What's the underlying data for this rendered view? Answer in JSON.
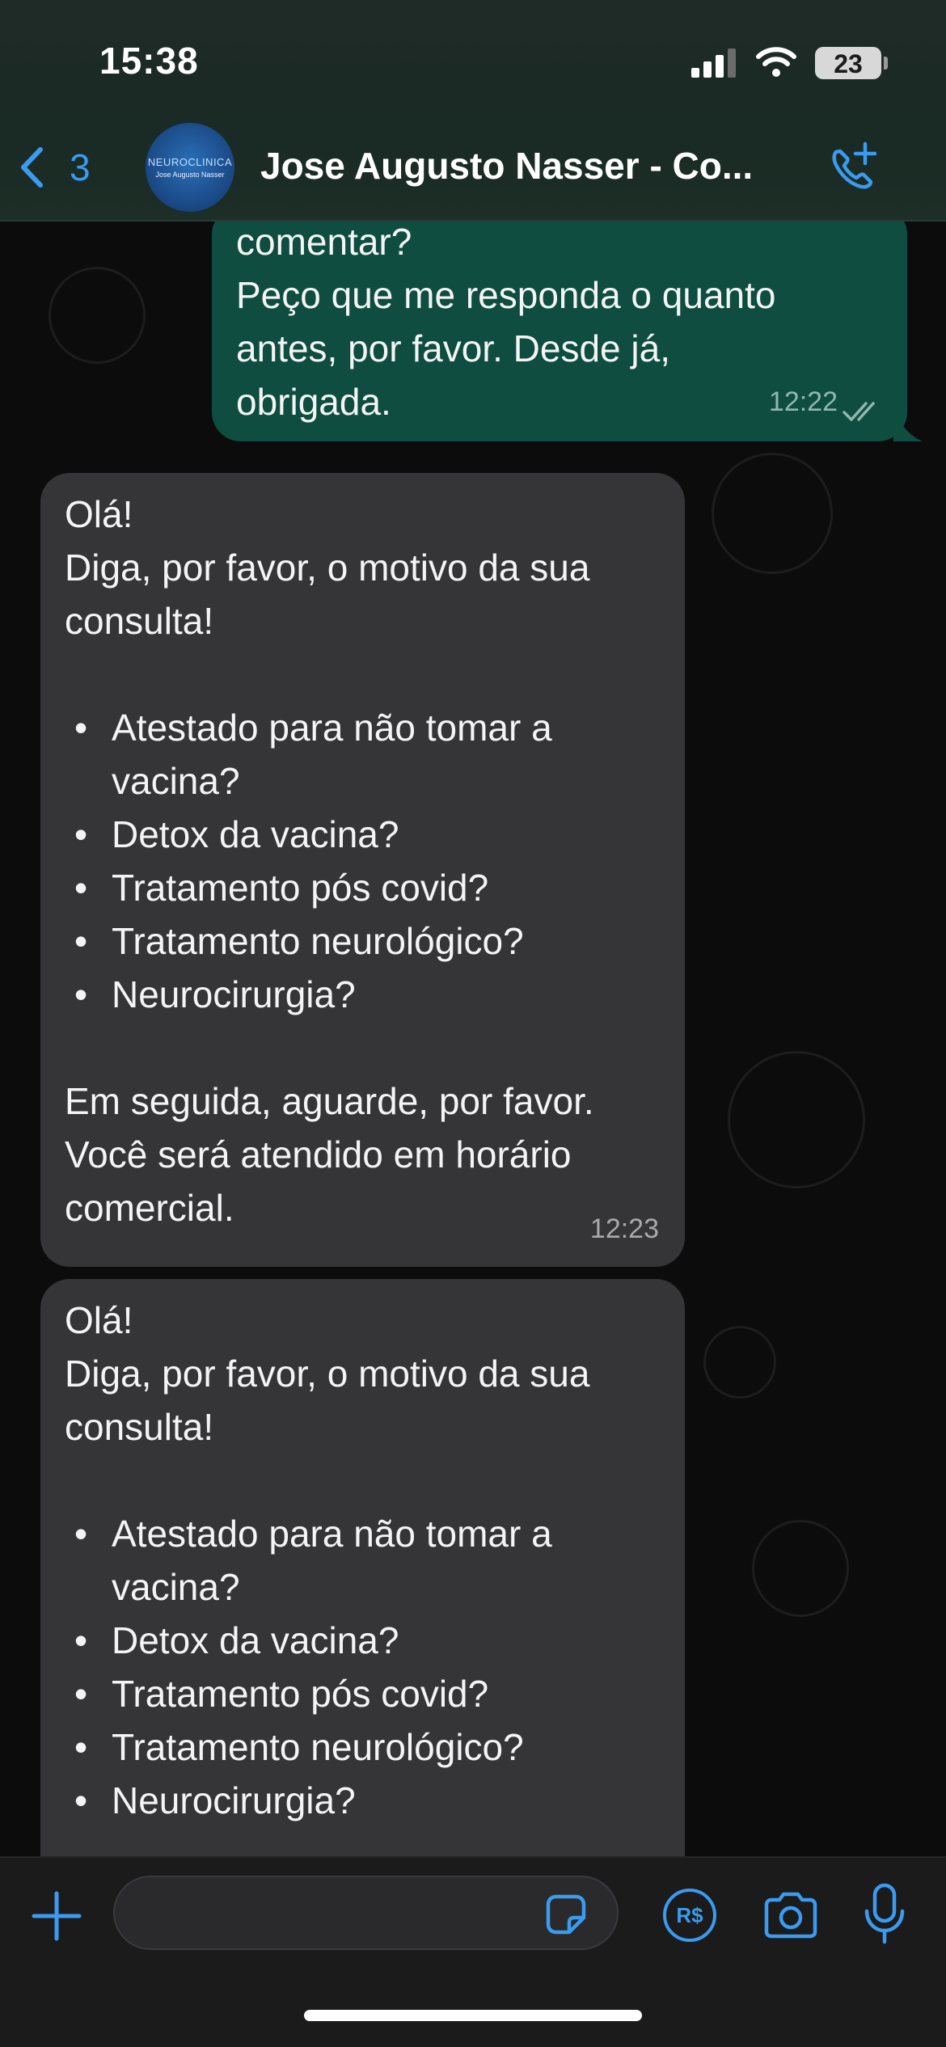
{
  "status_bar": {
    "time": "15:38",
    "battery": "23"
  },
  "header": {
    "back_count": "3",
    "contact_name": "Jose Augusto Nasser - Co...",
    "avatar_text_1": "NEUROCLINICA",
    "avatar_text_2": "Jose Augusto Nasser"
  },
  "messages": [
    {
      "direction": "outgoing",
      "text": "comentar?\nPeço que me responda o quanto\nantes, por favor. Desde já,\nobrigada.",
      "time": "12:22",
      "read_receipt": "double-check"
    },
    {
      "direction": "incoming",
      "intro": "Olá!\nDiga, por favor, o motivo da sua\nconsulta!",
      "bullets": [
        "Atestado para não tomar a vacina?",
        "Detox da vacina?",
        "Tratamento pós covid?",
        "Tratamento neurológico?",
        "Neurocirurgia?"
      ],
      "outro": "Em seguida, aguarde, por favor.\nVocê será atendido em horário\ncomercial.",
      "time": "12:23"
    },
    {
      "direction": "incoming",
      "intro": "Olá!\nDiga, por favor, o motivo da sua\nconsulta!",
      "bullets": [
        "Atestado para não tomar a vacina?",
        "Detox da vacina?",
        "Tratamento pós covid?",
        "Tratamento neurológico?",
        "Neurocirurgia?"
      ]
    }
  ],
  "composer": {
    "input_value": "",
    "pix_label": "R$"
  },
  "colors": {
    "accent": "#3a9bf0",
    "outgoing_bubble": "#0e4d40",
    "incoming_bubble": "#353537",
    "header_bg": "#1f2b27"
  },
  "icons": {
    "back": "chevron-left-icon",
    "call": "phone-plus-icon",
    "plus": "plus-icon",
    "sticker": "sticker-icon",
    "pix": "pix-icon",
    "camera": "camera-icon",
    "mic": "microphone-icon",
    "read": "double-check-icon"
  }
}
